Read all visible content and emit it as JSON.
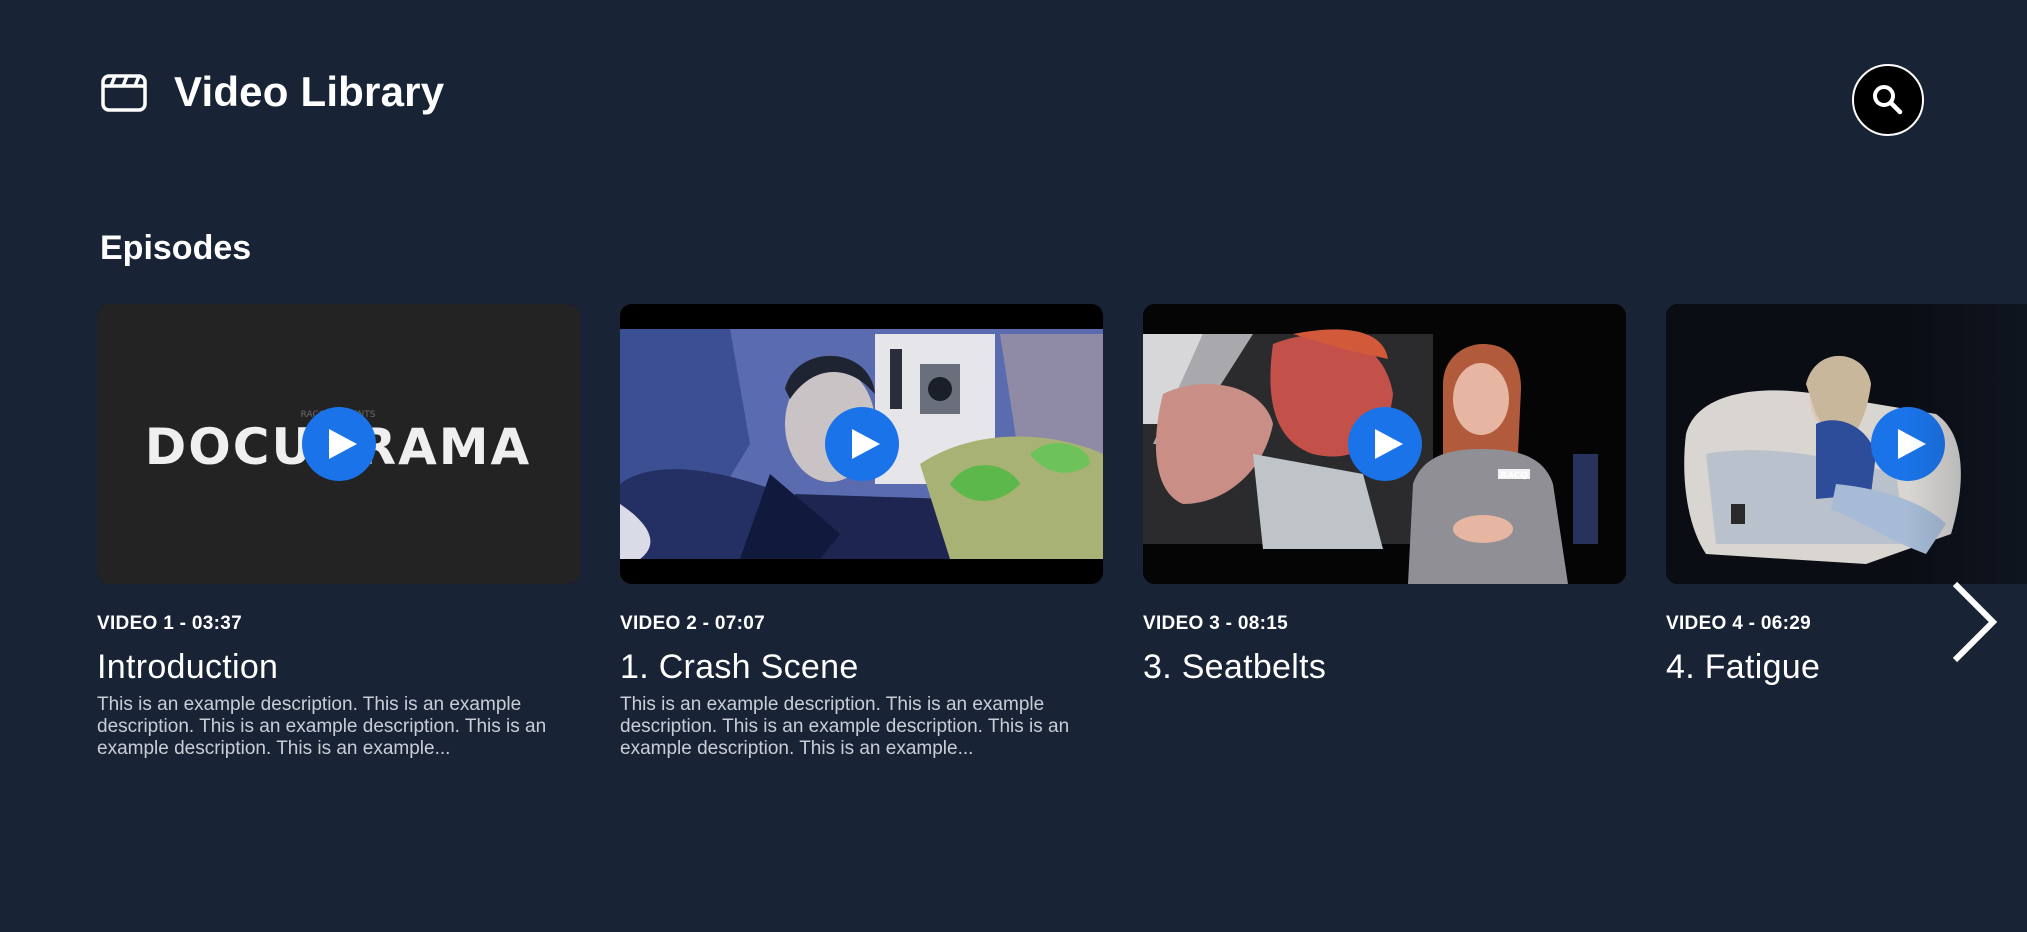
{
  "header": {
    "title": "Video Library",
    "logo_icon": "clapperboard-icon",
    "search_icon": "search-icon"
  },
  "section": {
    "title": "Episodes"
  },
  "colors": {
    "background": "#182335",
    "accent": "#1a73e8",
    "text": "#ffffff",
    "description": "#c9ced6"
  },
  "episodes": [
    {
      "meta": "VIDEO 1 - 03:37",
      "title": "Introduction",
      "description": "This is an example description. This is an example description. This is an example description. This is an example description. This is an example...",
      "thumbnail_text": "DOCUDRAMA",
      "thumbnail_caption": "RACO PRESENTS"
    },
    {
      "meta": "VIDEO 2 - 07:07",
      "title": "1. Crash Scene",
      "description": "This is an example description. This is an example description. This is an example description. This is an example description. This is an example..."
    },
    {
      "meta": "VIDEO 3 - 08:15",
      "title": "3. Seatbelts",
      "description": "",
      "thumbnail_text": "RACQ"
    },
    {
      "meta": "VIDEO 4 - 06:29",
      "title": "4. Fatigue",
      "description": ""
    }
  ],
  "carousel": {
    "next_icon": "chevron-right-icon"
  }
}
